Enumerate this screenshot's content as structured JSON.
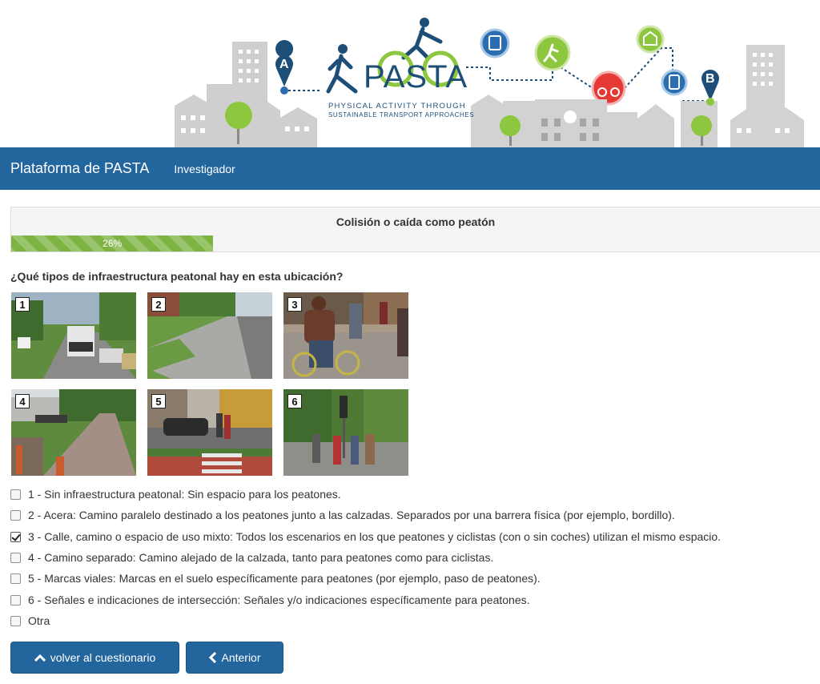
{
  "banner": {
    "brand_name": "PASTA",
    "tagline_line1": "PHYSICAL ACTIVITY THROUGH",
    "tagline_line2": "SUSTAINABLE TRANSPORT APPROACHES",
    "marker_a": "A",
    "marker_b": "B",
    "colors": {
      "navy": "#1d4e78",
      "green": "#8dc63f",
      "red": "#e53935",
      "blue": "#2a6db0",
      "building": "#c8c8c8"
    }
  },
  "navbar": {
    "brand": "Plataforma de PASTA",
    "link": "Investigador",
    "color": "#23669e"
  },
  "panel": {
    "title": "Colisión o caída como peatón",
    "progress_percent": 26,
    "progress_label": "26%"
  },
  "question": {
    "text": "¿Qué tipos de infraestructura peatonal hay en esta ubicación?"
  },
  "photos": [
    {
      "number": "1"
    },
    {
      "number": "2"
    },
    {
      "number": "3"
    },
    {
      "number": "4"
    },
    {
      "number": "5"
    },
    {
      "number": "6"
    }
  ],
  "options": [
    {
      "label": "1 - Sin infraestructura peatonal: Sin espacio para los peatones.",
      "checked": false
    },
    {
      "label": "2 - Acera: Camino paralelo destinado a los peatones junto a las calzadas. Separados por una barrera física (por ejemplo, bordillo).",
      "checked": false
    },
    {
      "label": "3 - Calle, camino o espacio de uso mixto: Todos los escenarios en los que peatones y ciclistas (con o sin coches) utilizan el mismo espacio.",
      "checked": true
    },
    {
      "label": "4 - Camino separado: Camino alejado de la calzada, tanto para peatones como para ciclistas.",
      "checked": false
    },
    {
      "label": "5 - Marcas viales: Marcas en el suelo específicamente para peatones (por ejemplo, paso de peatones).",
      "checked": false
    },
    {
      "label": "6 - Señales e indicaciones de intersección: Señales y/o indicaciones específicamente para peatones.",
      "checked": false
    },
    {
      "label": "Otra",
      "checked": false
    }
  ],
  "buttons": {
    "back_to_questionnaire": "volver al cuestionario",
    "previous": "Anterior"
  }
}
